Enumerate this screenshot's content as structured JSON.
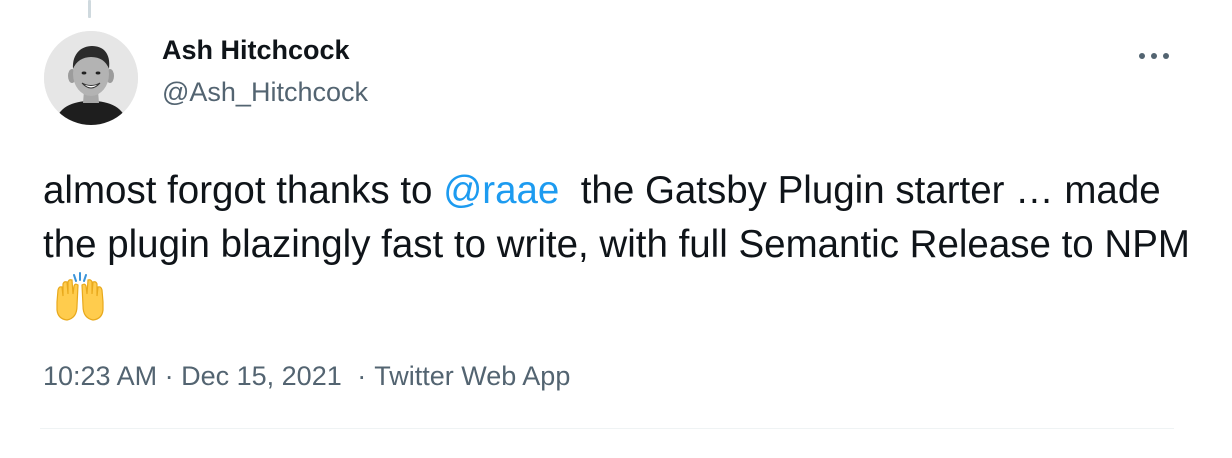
{
  "tweet": {
    "author": {
      "display_name": "Ash Hitchcock",
      "handle": "@Ash_Hitchcock",
      "avatar": "user-avatar-photo"
    },
    "more_icon": "more-horizontal-icon",
    "text": {
      "part1": "almost forgot thanks to",
      "mention": "@raae",
      "part2": "the Gatsby Plugin starter … made the plugin blazingly fast to write, with full Semantic Release to NPM",
      "emoji": "raising-hands-emoji"
    },
    "meta": {
      "time": "10:23 AM",
      "date": "Dec 15, 2021",
      "separator": "·",
      "source": "Twitter Web App"
    }
  },
  "colors": {
    "text": "#0f1419",
    "secondary": "#536471",
    "link": "#1d9bf0",
    "divider": "#eff3f4"
  }
}
